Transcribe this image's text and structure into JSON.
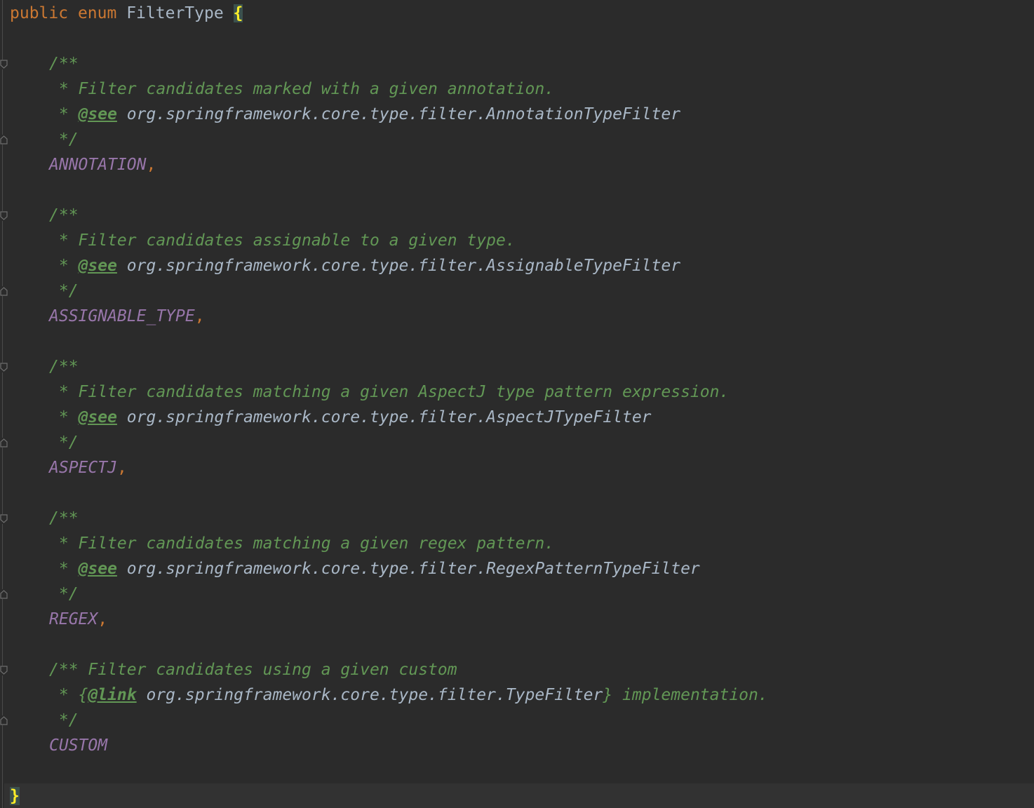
{
  "header": {
    "kw_public": "public",
    "kw_enum": "enum",
    "class_name": "FilterType",
    "open_brace": "{"
  },
  "close_brace": "}",
  "entries": [
    {
      "doc_open": "/**",
      "desc": " * Filter candidates marked with a given annotation.",
      "see_star": " * ",
      "see_tag": "@see",
      "see_ref": " org.springframework.core.type.filter.AnnotationTypeFilter",
      "doc_close": " */",
      "constant": "ANNOTATION",
      "comma": ","
    },
    {
      "doc_open": "/**",
      "desc": " * Filter candidates assignable to a given type.",
      "see_star": " * ",
      "see_tag": "@see",
      "see_ref": " org.springframework.core.type.filter.AssignableTypeFilter",
      "doc_close": " */",
      "constant": "ASSIGNABLE_TYPE",
      "comma": ","
    },
    {
      "doc_open": "/**",
      "desc": " * Filter candidates matching a given AspectJ type pattern expression.",
      "see_star": " * ",
      "see_tag": "@see",
      "see_ref": " org.springframework.core.type.filter.AspectJTypeFilter",
      "doc_close": " */",
      "constant": "ASPECTJ",
      "comma": ","
    },
    {
      "doc_open": "/**",
      "desc": " * Filter candidates matching a given regex pattern.",
      "see_star": " * ",
      "see_tag": "@see",
      "see_ref": " org.springframework.core.type.filter.RegexPatternTypeFilter",
      "doc_close": " */",
      "constant": "REGEX",
      "comma": ","
    }
  ],
  "custom": {
    "doc_open": "/** Filter candidates using a given custom",
    "link_prefix": " * {",
    "link_tag": "@link",
    "link_ref": " org.springframework.core.type.filter.TypeFilter",
    "link_suffix": "}",
    "link_tail": " implementation.",
    "doc_close": " */",
    "constant": "CUSTOM"
  }
}
